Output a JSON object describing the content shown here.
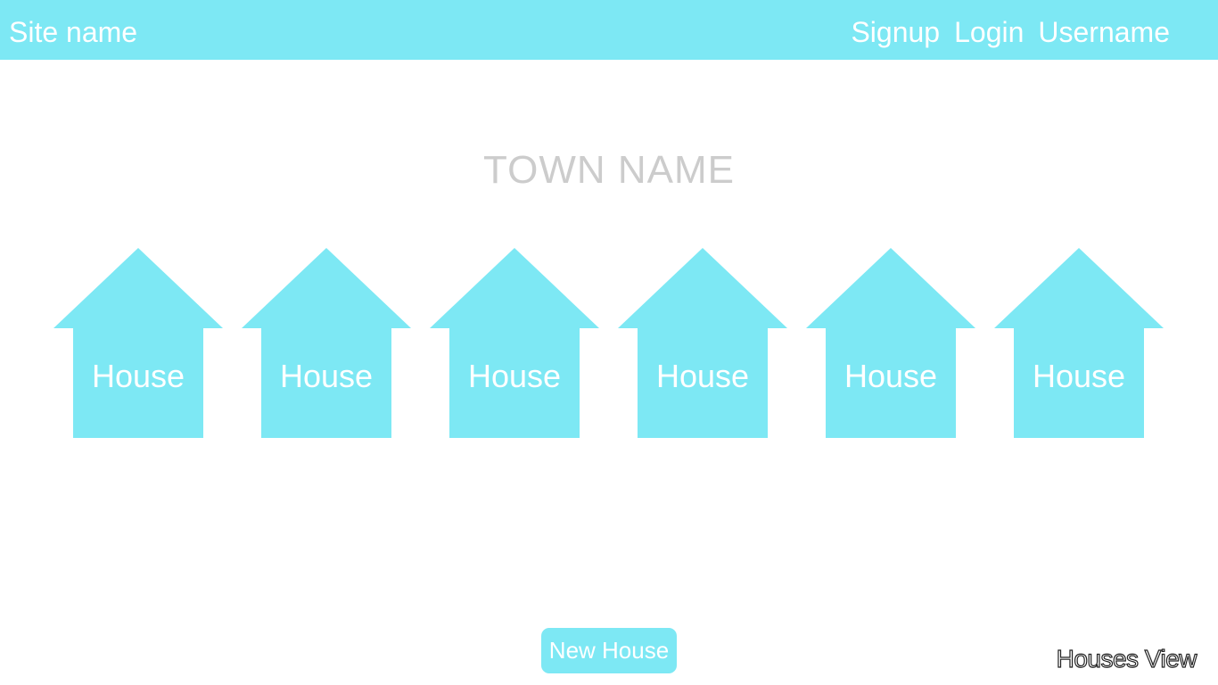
{
  "colors": {
    "accent": "#7de8f4",
    "text_on_accent": "#ffffff",
    "muted_heading": "#cccccc",
    "background": "#ffffff"
  },
  "navbar": {
    "site_name": "Site name",
    "links": [
      "Signup",
      "Login",
      "Username"
    ]
  },
  "town": {
    "name": "TOWN NAME"
  },
  "houses": [
    {
      "label": "House"
    },
    {
      "label": "House"
    },
    {
      "label": "House"
    },
    {
      "label": "House"
    },
    {
      "label": "House"
    },
    {
      "label": "House"
    }
  ],
  "actions": {
    "new_house_label": "New House"
  },
  "view": {
    "label": "Houses View"
  }
}
